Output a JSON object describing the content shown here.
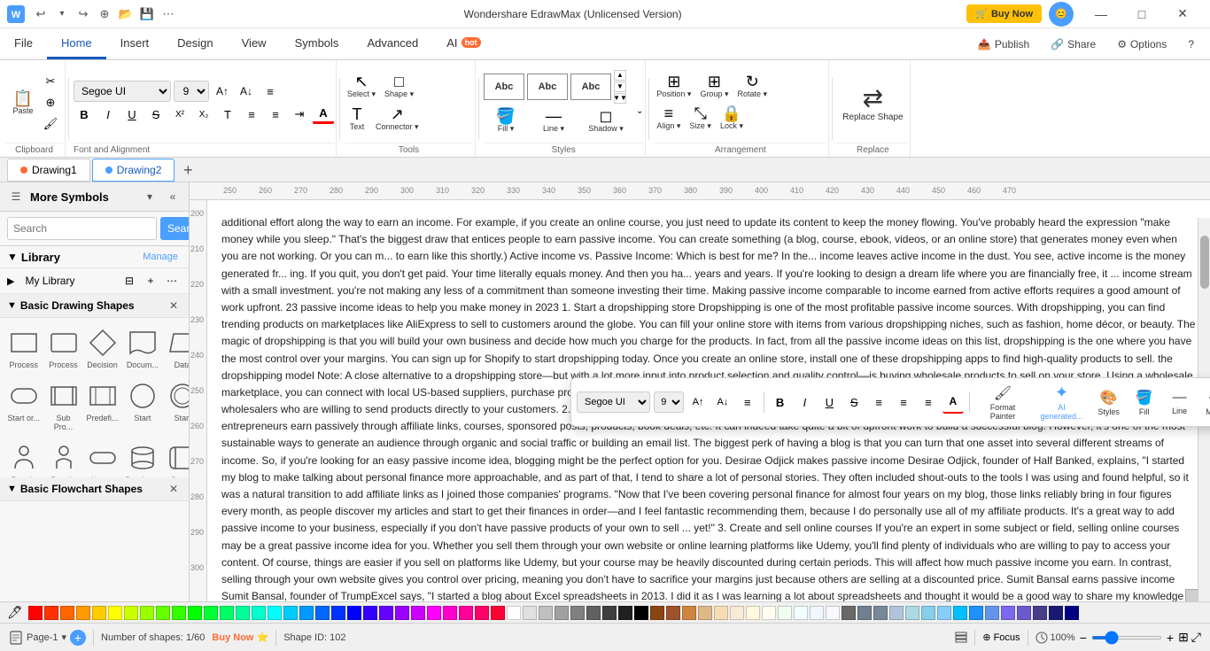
{
  "app": {
    "title": "Wondershare EdrawMax (Unlicensed Version)",
    "logo": "W"
  },
  "titlebar": {
    "undo_label": "↩",
    "redo_label": "↪",
    "new_label": "+",
    "open_label": "📂",
    "save_label": "💾",
    "more_label": "⋯",
    "minimize": "—",
    "maximize": "□",
    "close": "✕",
    "buy_now": "🛒 Buy Now"
  },
  "menubar": {
    "items": [
      "File",
      "Home",
      "Insert",
      "Design",
      "View",
      "Symbols",
      "Advanced"
    ],
    "ai_label": "AI",
    "ai_badge": "hot",
    "right": [
      "Publish",
      "Share",
      "Options",
      "?"
    ]
  },
  "ribbon": {
    "clipboard": {
      "label": "Clipboard",
      "paste": "📋",
      "cut": "✂",
      "copy": "⊕",
      "format_painter": "🖌"
    },
    "font": {
      "label": "Font and Alignment",
      "font_name": "Segoe UI",
      "font_size": "9",
      "bold": "B",
      "italic": "I",
      "underline": "U",
      "strikethrough": "S",
      "superscript": "X²",
      "subscript": "X₂",
      "font_color": "A",
      "align_left": "≡",
      "align_center": "≡",
      "align_right": "≡",
      "bullet": "≡",
      "indent": "≡",
      "expand_icon": "⌄"
    },
    "tools": {
      "label": "Tools",
      "select_label": "Select ▾",
      "shape_label": "Shape ▾",
      "text_label": "Text",
      "connector_label": "Connector ▾"
    },
    "styles": {
      "label": "Styles",
      "boxes": [
        "Abc",
        "Abc",
        "Abc"
      ],
      "fill_label": "Fill ▾",
      "line_label": "Line ▾",
      "shadow_label": "Shadow ▾",
      "expand_icon": "⌄"
    },
    "arrangement": {
      "label": "Arrangement",
      "position_label": "Position ▾",
      "group_label": "Group ▾",
      "rotate_label": "Rotate ▾",
      "align_label": "Align ▾",
      "size_label": "Size ▾",
      "lock_label": "Lock ▾"
    },
    "replace": {
      "label": "Replace",
      "replace_shape_label": "Replace Shape"
    }
  },
  "tabs": {
    "drawing1": {
      "label": "Drawing1",
      "dot_color": "#ff6b35"
    },
    "drawing2": {
      "label": "Drawing2",
      "dot_color": "#4a9eff"
    },
    "add": "+"
  },
  "left_panel": {
    "title": "More Symbols",
    "search_placeholder": "Search",
    "search_btn": "Search",
    "library_label": "Library",
    "manage_label": "Manage",
    "my_library_label": "My Library",
    "sections": [
      {
        "label": "Basic Drawing Shapes",
        "expanded": true
      },
      {
        "label": "Basic Flowchart Shapes",
        "expanded": true
      }
    ],
    "basic_shapes": [
      {
        "label": "Process",
        "shape": "rect"
      },
      {
        "label": "Process",
        "shape": "rect"
      },
      {
        "label": "Decision",
        "shape": "diamond"
      },
      {
        "label": "Docum...",
        "shape": "doc"
      },
      {
        "label": "Data",
        "shape": "parallelogram"
      },
      {
        "label": "Start or...",
        "shape": "rounded_rect"
      },
      {
        "label": "Sub Pro...",
        "shape": "double_rect"
      },
      {
        "label": "Predefi...",
        "shape": "predef"
      },
      {
        "label": "Start",
        "shape": "circle"
      },
      {
        "label": "Start",
        "shape": "circle"
      },
      {
        "label": "People",
        "shape": "person"
      },
      {
        "label": "People",
        "shape": "person"
      },
      {
        "label": "Yes or No",
        "shape": "diamond_sm"
      },
      {
        "label": "Database",
        "shape": "cylinder"
      },
      {
        "label": "Stored ...",
        "shape": "stored"
      },
      {
        "label": "Internal...",
        "shape": "rect_sm"
      }
    ]
  },
  "floating_toolbar": {
    "font": "Segoe UI",
    "size": "9",
    "grow_icon": "A↑",
    "shrink_icon": "A↓",
    "align_icon": "≡",
    "bold": "B",
    "italic": "I",
    "underline": "U",
    "strike": "S",
    "list_icon": "≡",
    "bullet_icon": "≡",
    "align2": "≡",
    "color_icon": "A",
    "format_painter": "🖌",
    "format_painter_label": "Format Painter",
    "ai_label": "AI generated...",
    "styles_label": "Styles",
    "fill_label": "Fill",
    "line_label": "Line",
    "more_label": "More"
  },
  "document_text": "additional effort along the way to earn an income. For example, if you create an online course, you just need to update its content to keep the money flowing. You've probably heard the expression \"make money while you sleep.\" That's the biggest draw that entices people to earn passive income. You can create something (a blog, course, ebook, videos, or an online store) that generates money even when you are not working. Or you can m... to earn like this shortly.) Active income vs. Passive Income: Which is best for me? In the... income leaves active income in the dust. You see, active income is the money generated fr... ing. If you quit, you don't get paid. Your time literally equals money. And then you ha... years and years. If you're looking to design a dream life where you are financially free, it ... income stream with a small investment. you're not making any less of a commitment than someone investing their time. Making passive income comparable to income earned from active efforts requires a good amount of work upfront. 23 passive income ideas to help you make money in 2023 1. Start a dropshipping store Dropshipping is one of the most profitable passive income sources. With dropshipping, you can find trending products on marketplaces like AliExpress to sell to customers around the globe. You can fill your online store with items from various dropshipping niches, such as fashion, home décor, or beauty. The magic of dropshipping is that you will build your own business and decide how much you charge for the products. In fact, from all the passive income ideas on this list, dropshipping is the one where you have the most control over your margins. You can sign up for Shopify to start dropshipping today. Once you create an online store, install one of these dropshipping apps to find high-quality products to sell. the dropshipping model Note: A close alternative to a dropshipping store—but with a lot more input into product selection and quality control—is buying wholesale products to sell on your store. Using a wholesale marketplace, you can connect with local US-based suppliers, purchase products at wholesale prices, and sell them on to your audience. You can even combine this option with dropshipping by finding wholesalers who are willing to send products directly to your customers. 2. Build and monetize a blog Another popular passive income stream originates from blogging. Blogging has helped countless entrepreneurs earn passively through affiliate links, courses, sponsored posts, products, book deals, etc. It can indeed take quite a bit of upfront work to build a successful blog. However, it's one of the most sustainable ways to generate an audience through organic and social traffic or building an email list. The biggest perk of having a blog is that you can turn that one asset into several different streams of income. So, if you're looking for an easy passive income idea, blogging might be the perfect option for you. Desirae Odjick makes passive income Desirae Odjick, founder of Half Banked, explains, \"I started my blog to make talking about personal finance more approachable, and as part of that, I tend to share a lot of personal stories. They often included shout-outs to the tools I was using and found helpful, so it was a natural transition to add affiliate links as I joined those companies' programs. \"Now that I've been covering personal finance for almost four years on my blog, those links reliably bring in four figures every month, as people discover my articles and start to get their finances in order—and I feel fantastic recommending them, because I do personally use all of my affiliate products. It's a great way to add passive income to your business, especially if you don't have passive products of your own to sell ... yet!\" 3. Create and sell online courses If you're an expert in some subject or field, selling online courses may be a great passive income idea for you. Whether you sell them through your own website or online learning platforms like Udemy, you'll find plenty of individuals who are willing to pay to access your content. Of course, things are easier if you sell on platforms like Udemy, but your course may be heavily discounted during certain periods. This will affect how much passive income you earn. In contrast, selling through your own website gives you control over pricing, meaning you don't have to sacrifice your margins just because others are selling at a discounted price. Sumit Bansal earns passive income Sumit Bansal, founder of TrumpExcel says, \"I started a blog about Excel spreadsheets in 2013. I did it as I was learning a lot about spreadsheets and thought it would be a good way to share my knowledge with others. It slowly started getting traction in two years; it was getting 100,000+ page views a month. I decided to create an online course and see if it would fly, and it did. I made a good side income for a few months and then decided to do this full time and launch more courses. Since then, the blog has grown a lot, and I have been featured on many prominent sites and publications such as Problogger, YourStory, GlassDoor, CEO Magazine, etc.\" 4. Publish Instagram sponsored posts If you have followers on Instagram, you might want to try your hand at creating sponsored content. Instagram sponsored posts are content pieces that endorse a specific product or service (usually owned by the sponsoring party). Sponsors compensate publishers for creating and distributing content that promotes their business. The secret to getting sponsored is to get more Instagram followers. You'll also want to be super consistent with the type of content you post so sponsors know what to expect. And be sure to focus on just one niche—brands prefer creators who can publish quality content around a specific",
  "statusbar": {
    "page_label": "Page-1",
    "shapes_label": "Number of shapes: 1/60",
    "buy_now": "Buy Now",
    "shape_id": "Shape ID: 102",
    "focus_label": "Focus",
    "zoom_label": "100%",
    "zoom_minus": "−",
    "zoom_plus": "+"
  },
  "colors": [
    "#ff0000",
    "#ff3300",
    "#ff6600",
    "#ff9900",
    "#ffcc00",
    "#ffff00",
    "#ccff00",
    "#99ff00",
    "#66ff00",
    "#33ff00",
    "#00ff00",
    "#00ff33",
    "#00ff66",
    "#00ff99",
    "#00ffcc",
    "#00ffff",
    "#00ccff",
    "#0099ff",
    "#0066ff",
    "#0033ff",
    "#0000ff",
    "#3300ff",
    "#6600ff",
    "#9900ff",
    "#cc00ff",
    "#ff00ff",
    "#ff00cc",
    "#ff0099",
    "#ff0066",
    "#ff0033",
    "#ffffff",
    "#e0e0e0",
    "#c0c0c0",
    "#a0a0a0",
    "#808080",
    "#606060",
    "#404040",
    "#202020",
    "#000000",
    "#8B4513",
    "#A0522D",
    "#CD853F",
    "#DEB887",
    "#F5DEB3",
    "#FAEBD7",
    "#FFF8DC",
    "#FFFFF0",
    "#F0FFF0",
    "#F0FFFF",
    "#F0F8FF",
    "#F8F8FF",
    "#696969",
    "#708090",
    "#778899",
    "#B0C4DE",
    "#ADD8E6",
    "#87CEEB",
    "#87CEFA",
    "#00BFFF",
    "#1E90FF",
    "#6495ED",
    "#7B68EE",
    "#6A5ACD",
    "#483D8B",
    "#191970",
    "#000080"
  ]
}
